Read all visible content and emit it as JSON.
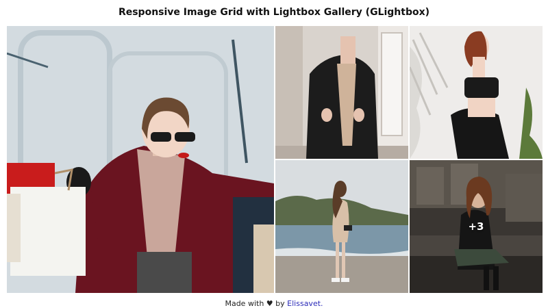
{
  "page": {
    "title": "Responsive Image Grid with Lightbox Gallery (GLightbox)"
  },
  "gallery": {
    "images": [
      {
        "name": "woman-with-shopping-bags"
      },
      {
        "name": "woman-in-black-blazer"
      },
      {
        "name": "woman-in-black-crop-top-and-skirt"
      },
      {
        "name": "woman-on-beach"
      },
      {
        "name": "woman-sitting-by-fountain"
      }
    ],
    "more_count": "+3"
  },
  "footer": {
    "made_with": "Made with",
    "heart": "♥",
    "by": "by",
    "author": "Elissavet."
  },
  "colors": {
    "link": "#2a2ab8",
    "text": "#111111"
  }
}
